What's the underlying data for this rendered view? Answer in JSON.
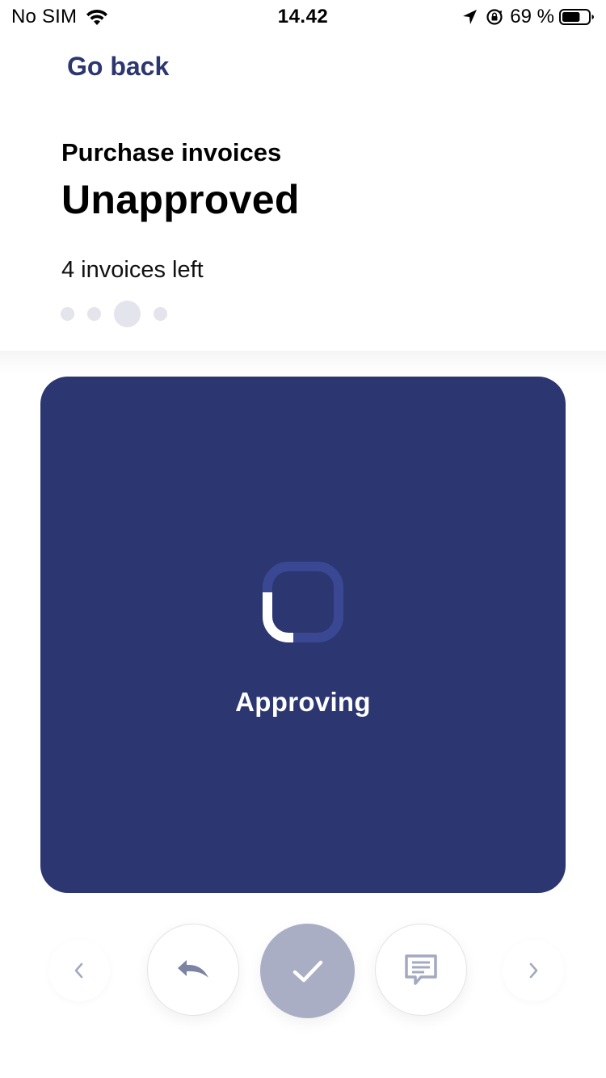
{
  "status_bar": {
    "carrier": "No SIM",
    "time": "14.42",
    "battery_percent": "69 %",
    "battery_level": 0.69,
    "icons": [
      "wifi-icon",
      "location-arrow-icon",
      "orientation-lock-icon",
      "battery-icon"
    ]
  },
  "header": {
    "back_label": "Go back",
    "subtitle": "Purchase invoices",
    "title": "Unapproved",
    "remaining": "4 invoices left",
    "pager": {
      "count": 4,
      "active_index": 2
    }
  },
  "card": {
    "status_text": "Approving",
    "background_color": "#2c3670",
    "spinner_icon": "loading-spinner-icon"
  },
  "controls": {
    "icons": [
      "chevron-left-icon",
      "undo-icon",
      "check-icon",
      "comment-icon",
      "chevron-right-icon"
    ],
    "approve_color": "#a9aec5"
  },
  "colors": {
    "accent": "#2c3670",
    "dot_inactive": "#e3e4ec",
    "icon_muted": "#a4a9c0"
  }
}
